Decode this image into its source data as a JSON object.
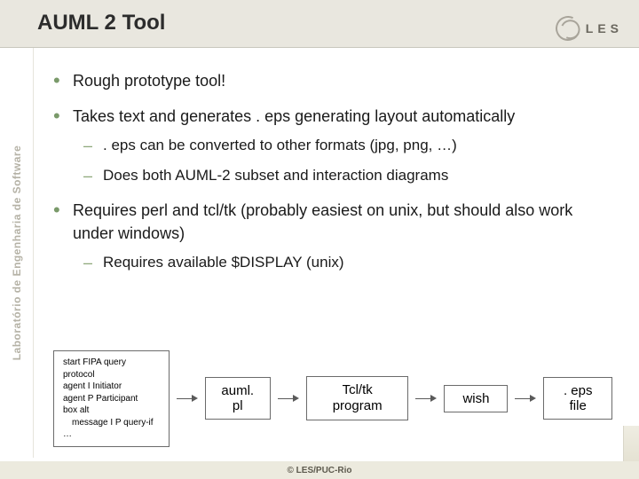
{
  "title": "AUML 2 Tool",
  "logo_text": "LES",
  "left_label": "Laboratório de Engenharia de Software",
  "bullets": {
    "b0": "Rough prototype tool!",
    "b1": "Takes text and generates . eps generating layout automatically",
    "b1_sub0": ". eps can be converted to other formats (jpg, png, …)",
    "b1_sub1": "Does both AUML-2 subset and interaction diagrams",
    "b2": "Requires perl and tcl/tk (probably easiest on unix, but should also work under windows)",
    "b2_sub0": "Requires available $DISPLAY (unix)"
  },
  "pipeline": {
    "code_l0": "start FIPA query protocol",
    "code_l1": "agent I Initiator",
    "code_l2": "agent P Participant",
    "code_l3": "box alt",
    "code_l4": "message I P query-if",
    "code_l5": "…",
    "box1": "auml. pl",
    "box2": "Tcl/tk program",
    "box3": "wish",
    "box4": ". eps file"
  },
  "footer": "© LES/PUC-Rio"
}
